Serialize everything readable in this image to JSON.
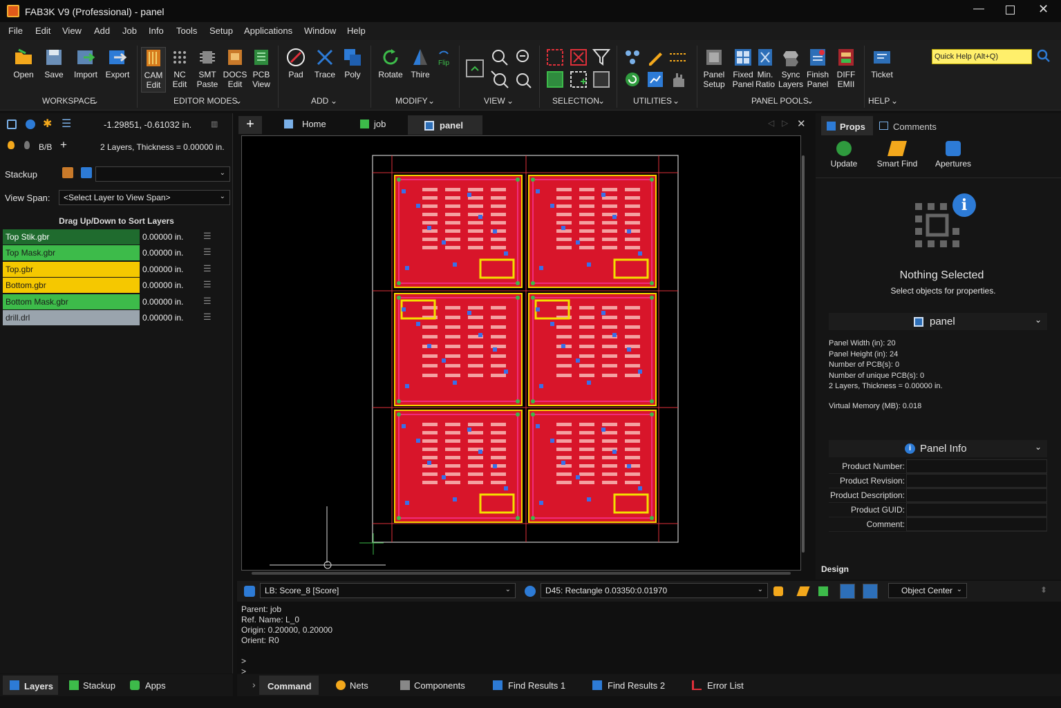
{
  "window": {
    "title": "FAB3K V9 (Professional) - panel"
  },
  "menu": [
    "File",
    "Edit",
    "View",
    "Add",
    "Job",
    "Info",
    "Tools",
    "Setup",
    "Applications",
    "Window",
    "Help"
  ],
  "ribbon": {
    "buttons": [
      {
        "label": "Open"
      },
      {
        "label": "Save"
      },
      {
        "label": "Import"
      },
      {
        "label": "Export"
      },
      {
        "label": "CAM\nEdit"
      },
      {
        "label": "NC\nEdit"
      },
      {
        "label": "SMT\nPaste"
      },
      {
        "label": "DOCS\nEdit"
      },
      {
        "label": "PCB\nView"
      },
      {
        "label": "Pad"
      },
      {
        "label": "Trace"
      },
      {
        "label": "Poly"
      },
      {
        "label": "Rotate"
      },
      {
        "label": "Thire"
      },
      {
        "label": "Flip"
      },
      {
        "label": "Panel\nSetup"
      },
      {
        "label": "Fixed\nPanel"
      },
      {
        "label": "Min.\nRatio"
      },
      {
        "label": "Sync\nLayers"
      },
      {
        "label": "Finish\nPanel"
      },
      {
        "label": "DIFF\nEMII"
      },
      {
        "label": "Ticket"
      }
    ],
    "groups": [
      "WORKSPACE",
      "EDITOR MODES",
      "ADD",
      "MODIFY",
      "VIEW",
      "SELECTION",
      "UTILITIES",
      "PANEL POOLS",
      "HELP"
    ],
    "quick_help": "Quick Help (Alt+Q)"
  },
  "left": {
    "coords": "-1.29851, -0.61032 in.",
    "view_label": "B/B",
    "layers_info": "2 Layers, Thickness = 0.00000 in.",
    "stackup_label": "Stackup",
    "viewspan_label": "View Span:",
    "viewspan_value": "<Select Layer to View Span>",
    "sort_hint": "Drag Up/Down to Sort Layers",
    "layers": [
      {
        "name": "Top Stik.gbr",
        "thickness": "0.00000 in.",
        "color": "#1f6b2e",
        "text": "#ffffff"
      },
      {
        "name": "Top Mask.gbr",
        "thickness": "0.00000 in.",
        "color": "#3dbb4a",
        "text": "#1a1a1a"
      },
      {
        "name": "Top.gbr",
        "thickness": "0.00000 in.",
        "color": "#f5c800",
        "text": "#1a1a1a"
      },
      {
        "name": "Bottom.gbr",
        "thickness": "0.00000 in.",
        "color": "#f5c800",
        "text": "#1a1a1a"
      },
      {
        "name": "Bottom Mask.gbr",
        "thickness": "0.00000 in.",
        "color": "#3dbb4a",
        "text": "#1a1a1a"
      },
      {
        "name": "drill.drl",
        "thickness": "0.00000 in.",
        "color": "#9aa4ad",
        "text": "#1a1a1a"
      }
    ],
    "tabs": [
      "Layers",
      "Stackup",
      "Apps"
    ]
  },
  "doc_tabs": [
    "Home",
    "job",
    "panel"
  ],
  "right": {
    "tabs": [
      "Props",
      "Comments"
    ],
    "tools": [
      "Update",
      "Smart Find",
      "Apertures"
    ],
    "nothing_title": "Nothing Selected",
    "nothing_sub": "Select objects for properties.",
    "panel_header": "panel",
    "panel_props": [
      "Panel Width (in):  20",
      "Panel Height (in):  24",
      "Number of PCB(s): 0",
      "Number of unique PCB(s): 0",
      "2 Layers, Thickness = 0.00000 in."
    ],
    "virtual_memory": "Virtual Memory (MB): 0.018",
    "info_header": "Panel Info",
    "info_fields": [
      "Product Number:",
      "Product Revision:",
      "Product Description:",
      "Product GUID:",
      "Comment:"
    ],
    "design_label": "Design"
  },
  "cmdbar": {
    "layer_select": "LB: Score_8 [Score]",
    "dcode_select": "D45: Rectangle 0.03350:0.01970",
    "snap": "Object Center"
  },
  "output": [
    "Parent: job",
    "Ref. Name: L_0",
    "Origin: 0.20000, 0.20000",
    "Orient: R0",
    "",
    ">",
    ">"
  ],
  "bottom_tabs": [
    "Command",
    "Nets",
    "Components",
    "Find Results 1",
    "Find Results 2",
    "Error List"
  ],
  "colors": {
    "accent": "#2d7bd6",
    "board_red": "#d8152a",
    "quick_help_bg": "#ffef6b"
  }
}
